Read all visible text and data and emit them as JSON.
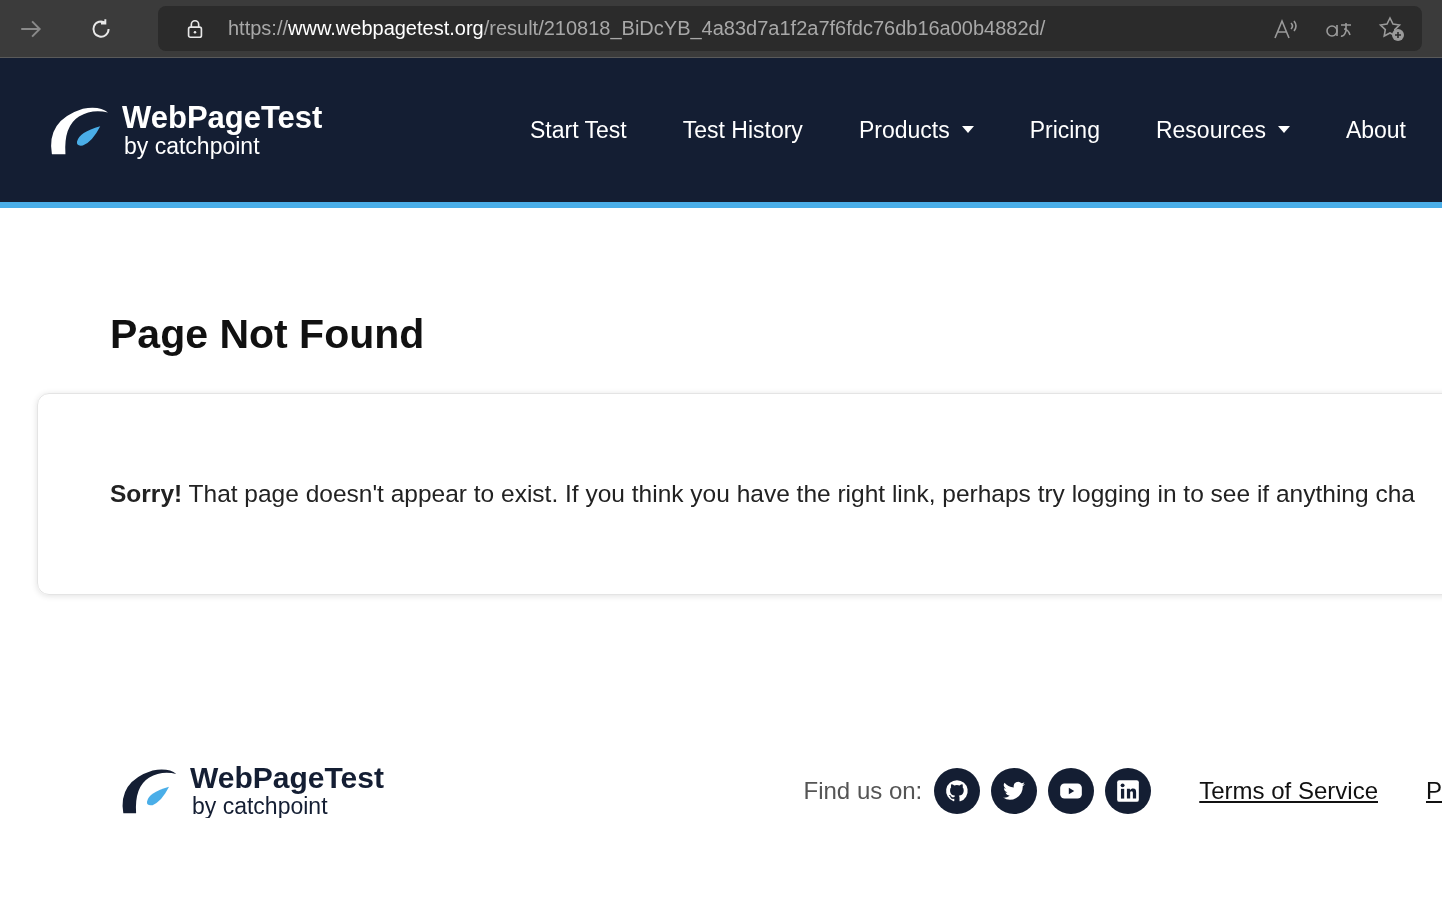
{
  "browser": {
    "url_scheme": "https://",
    "url_host": "www.webpagetest.org",
    "url_path": "/result/210818_BiDcYB_4a83d7a1f2a7f6fdc76db16a00b4882d/"
  },
  "header": {
    "logo_title": "WebPageTest",
    "logo_subtitle": "by catchpoint",
    "nav": [
      {
        "label": "Start Test",
        "has_menu": false
      },
      {
        "label": "Test History",
        "has_menu": false
      },
      {
        "label": "Products",
        "has_menu": true
      },
      {
        "label": "Pricing",
        "has_menu": false
      },
      {
        "label": "Resources",
        "has_menu": true
      },
      {
        "label": "About",
        "has_menu": false
      }
    ]
  },
  "page_title": "Page Not Found",
  "message": "**Sorry!** That page doesn't appear to exist. If you think you have the right link, perhaps try logging in to see if anything cha",
  "footer": {
    "logo_title": "WebPageTest",
    "logo_subtitle": "by catchpoint",
    "find_us": "Find us on:",
    "social": [
      {
        "kind": "github"
      },
      {
        "kind": "twitter"
      },
      {
        "kind": "youtube"
      },
      {
        "kind": "linkedin"
      }
    ],
    "links": [
      "Terms of Service",
      "P"
    ]
  }
}
